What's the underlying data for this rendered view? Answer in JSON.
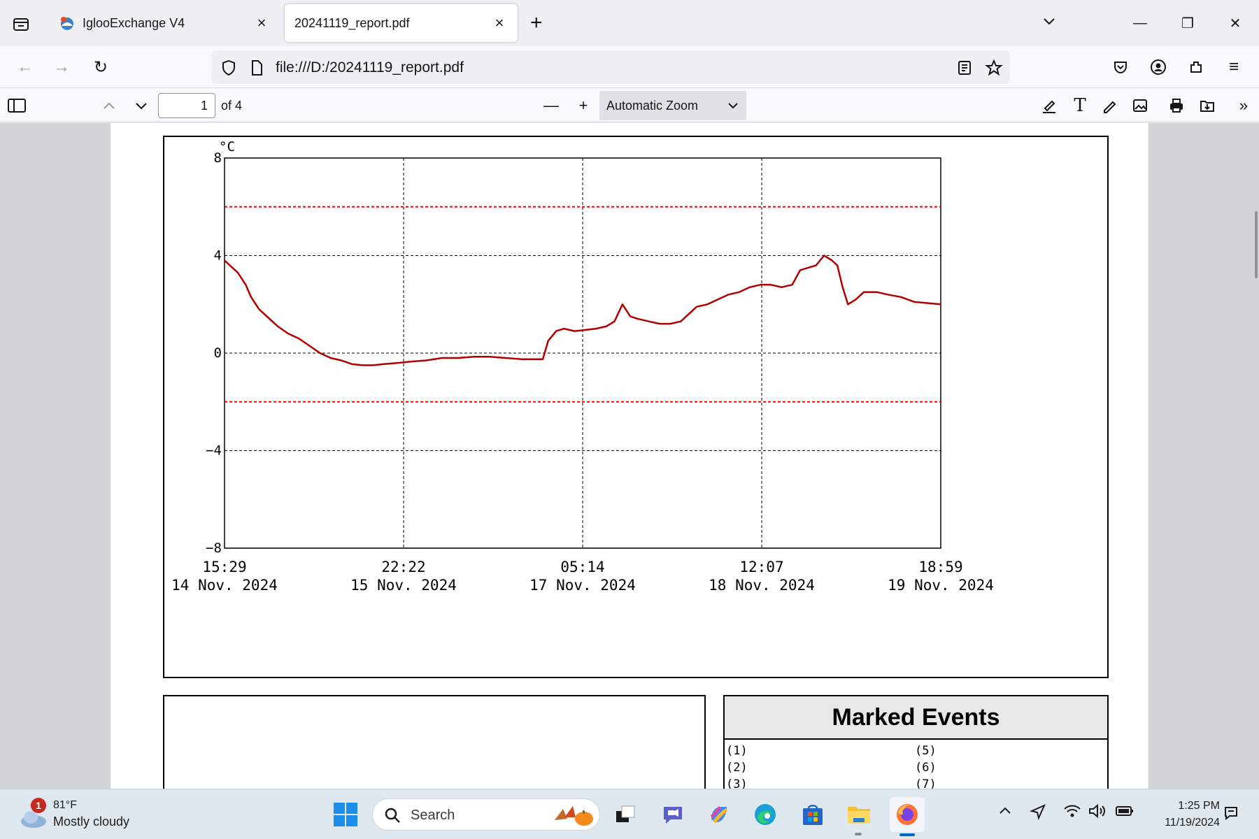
{
  "browser": {
    "tabs": [
      {
        "title": "IglooExchange V4",
        "active": false
      },
      {
        "title": "20241119_report.pdf",
        "active": true
      }
    ],
    "url": "file:///D:/20241119_report.pdf"
  },
  "pdf_toolbar": {
    "page_current": "1",
    "page_total_label": "of 4",
    "zoom_label": "Automatic Zoom"
  },
  "chart_data": {
    "type": "line",
    "title": "",
    "unit_label": "°C",
    "ylim": [
      -8,
      8
    ],
    "y_ticks": [
      "8",
      "4",
      "0",
      "−4",
      "−8"
    ],
    "x_ticks": [
      {
        "time": "15:29",
        "date": "14 Nov. 2024"
      },
      {
        "time": "22:22",
        "date": "15 Nov. 2024"
      },
      {
        "time": "05:14",
        "date": "17 Nov. 2024"
      },
      {
        "time": "12:07",
        "date": "18 Nov. 2024"
      },
      {
        "time": "18:59",
        "date": "19 Nov. 2024"
      }
    ],
    "limits": [
      6,
      -2
    ],
    "limit_color": "#ff0000",
    "series_color": "#b00000",
    "series": [
      {
        "values": [
          [
            0.0,
            3.8
          ],
          [
            0.2,
            3.6
          ],
          [
            0.5,
            3.3
          ],
          [
            0.8,
            2.8
          ],
          [
            1.0,
            2.3
          ],
          [
            1.3,
            1.8
          ],
          [
            1.6,
            1.5
          ],
          [
            2.0,
            1.1
          ],
          [
            2.4,
            0.8
          ],
          [
            2.8,
            0.6
          ],
          [
            3.2,
            0.3
          ],
          [
            3.6,
            0.0
          ],
          [
            4.0,
            -0.2
          ],
          [
            4.4,
            -0.3
          ],
          [
            4.8,
            -0.45
          ],
          [
            5.2,
            -0.5
          ],
          [
            5.6,
            -0.5
          ],
          [
            6.0,
            -0.45
          ],
          [
            6.6,
            -0.4
          ],
          [
            7.0,
            -0.35
          ],
          [
            7.6,
            -0.3
          ],
          [
            8.2,
            -0.2
          ],
          [
            8.8,
            -0.2
          ],
          [
            9.4,
            -0.15
          ],
          [
            10.0,
            -0.15
          ],
          [
            10.6,
            -0.2
          ],
          [
            11.2,
            -0.25
          ],
          [
            12.0,
            -0.25
          ],
          [
            12.2,
            0.5
          ],
          [
            12.5,
            0.9
          ],
          [
            12.8,
            1.0
          ],
          [
            13.2,
            0.9
          ],
          [
            13.6,
            0.95
          ],
          [
            14.0,
            1.0
          ],
          [
            14.4,
            1.1
          ],
          [
            14.7,
            1.3
          ],
          [
            15.0,
            2.0
          ],
          [
            15.3,
            1.5
          ],
          [
            15.6,
            1.4
          ],
          [
            16.0,
            1.3
          ],
          [
            16.4,
            1.2
          ],
          [
            16.8,
            1.2
          ],
          [
            17.2,
            1.3
          ],
          [
            17.5,
            1.6
          ],
          [
            17.8,
            1.9
          ],
          [
            18.2,
            2.0
          ],
          [
            18.6,
            2.2
          ],
          [
            19.0,
            2.4
          ],
          [
            19.4,
            2.5
          ],
          [
            19.8,
            2.7
          ],
          [
            20.2,
            2.8
          ],
          [
            20.6,
            2.8
          ],
          [
            21.0,
            2.7
          ],
          [
            21.4,
            2.8
          ],
          [
            21.7,
            3.4
          ],
          [
            22.0,
            3.5
          ],
          [
            22.3,
            3.6
          ],
          [
            22.6,
            4.0
          ],
          [
            22.9,
            3.8
          ],
          [
            23.1,
            3.6
          ],
          [
            23.3,
            2.7
          ],
          [
            23.5,
            2.0
          ],
          [
            23.8,
            2.2
          ],
          [
            24.1,
            2.5
          ],
          [
            24.6,
            2.5
          ],
          [
            25.0,
            2.4
          ],
          [
            25.5,
            2.3
          ],
          [
            26.0,
            2.1
          ],
          [
            26.5,
            2.05
          ],
          [
            27.0,
            2.0
          ]
        ]
      }
    ]
  },
  "marked_events": {
    "title": "Marked Events",
    "items": [
      "(1)",
      "(5)",
      "(2)",
      "(6)",
      "(3)",
      "(7)"
    ]
  },
  "taskbar": {
    "weather_badge": "1",
    "temperature": "81°F",
    "condition": "Mostly cloudy",
    "search_label": "Search",
    "time": "1:25 PM",
    "date": "11/19/2024"
  }
}
